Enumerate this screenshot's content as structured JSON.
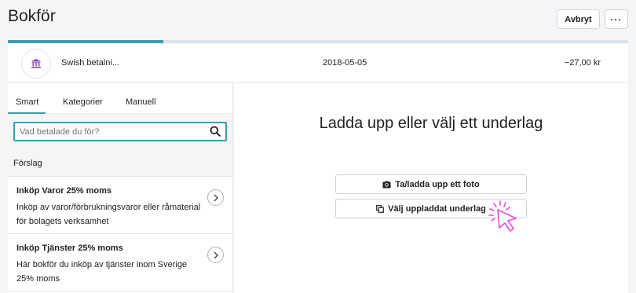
{
  "header": {
    "title": "Bokför",
    "cancel_label": "Avbryt",
    "more_label": "···"
  },
  "progress": {
    "fraction": 0.25
  },
  "transaction": {
    "icon": "bank-icon",
    "name": "Swish betalni...",
    "date": "2018-05-05",
    "amount": "−27,00 kr"
  },
  "tabs": [
    {
      "label": "Smart",
      "active": true
    },
    {
      "label": "Kategorier",
      "active": false
    },
    {
      "label": "Manuell",
      "active": false
    }
  ],
  "search": {
    "placeholder": "Vad betalade du för?",
    "value": ""
  },
  "suggestions": {
    "heading": "Förslag",
    "items": [
      {
        "title": "Inköp Varor 25% moms",
        "description": "Inköp av varor/förbrukningsvaror eller råmaterial för bolagets verksamhet"
      },
      {
        "title": "Inköp Tjänster 25% moms",
        "description": "Här bokför du inköp av tjänster inom Sverige 25% moms"
      }
    ]
  },
  "upload": {
    "heading": "Ladda upp eller välj ett underlag",
    "photo_button": "Ta/ladda upp ett foto",
    "choose_button": "Välj uppladdat underlag"
  },
  "colors": {
    "accent": "#3c9cb0",
    "bank_icon": "#8e44ad",
    "cursor": "#e84ad8"
  }
}
